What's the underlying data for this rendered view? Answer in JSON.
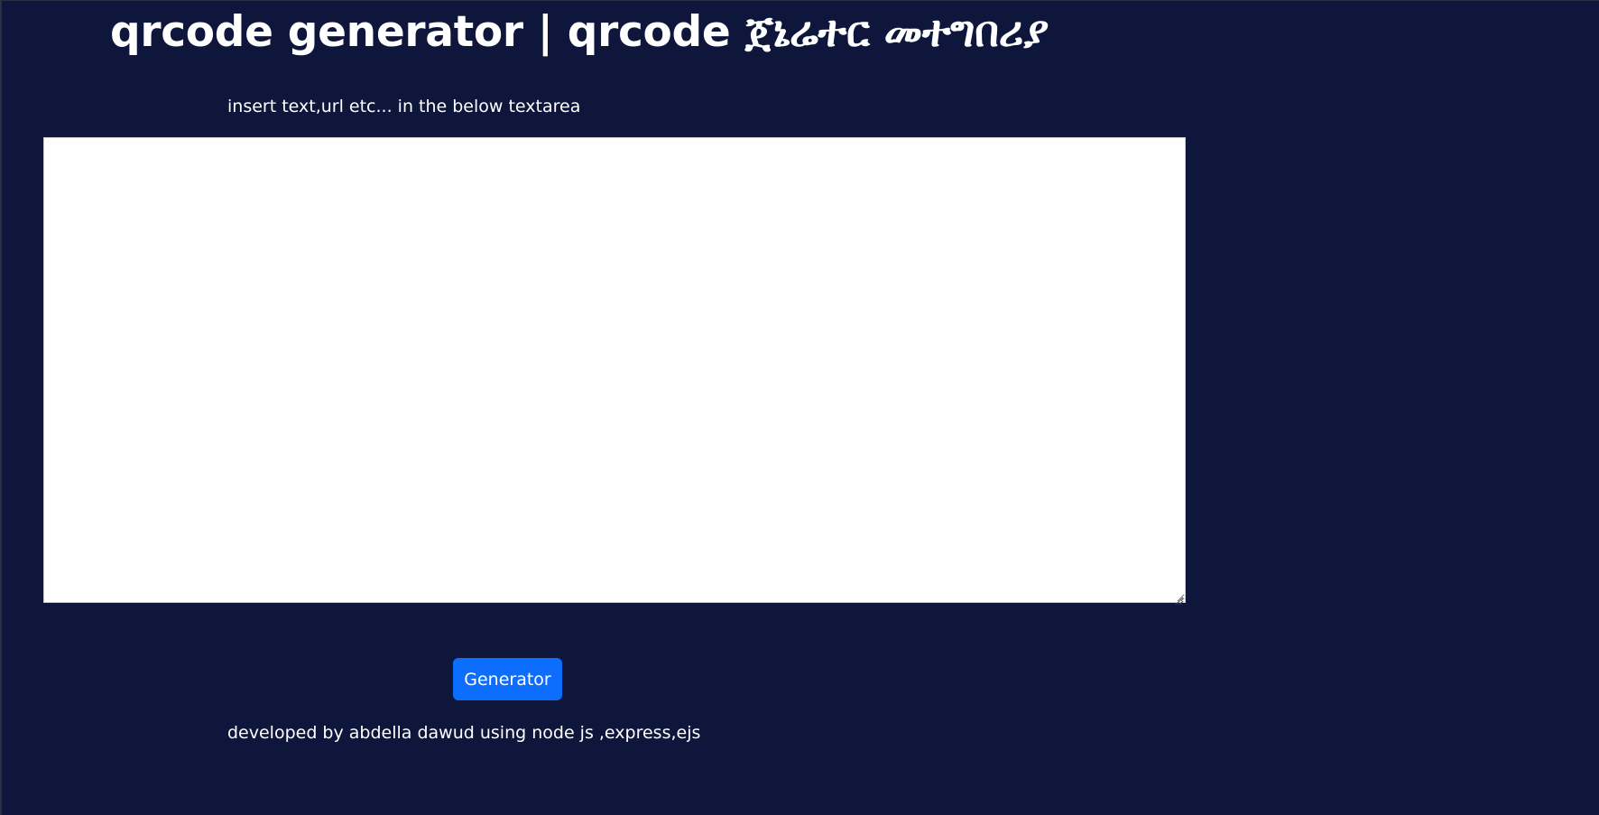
{
  "page": {
    "title": "qrcode generator | qrcode ጀኔሬተር መተግበሪያ",
    "instructions": "insert text,url etc... in the below textarea",
    "textarea": {
      "value": "",
      "placeholder": ""
    },
    "generate_button_label": "Generator",
    "footer_credit": "developed by abdella dawud using node js ,express,ejs"
  },
  "colors": {
    "background": "#0e163c",
    "button": "#0d6efd",
    "text": "#ffffff",
    "textarea_bg": "#ffffff"
  },
  "icons": {
    "textarea_resize": "resize-grip-icon"
  }
}
